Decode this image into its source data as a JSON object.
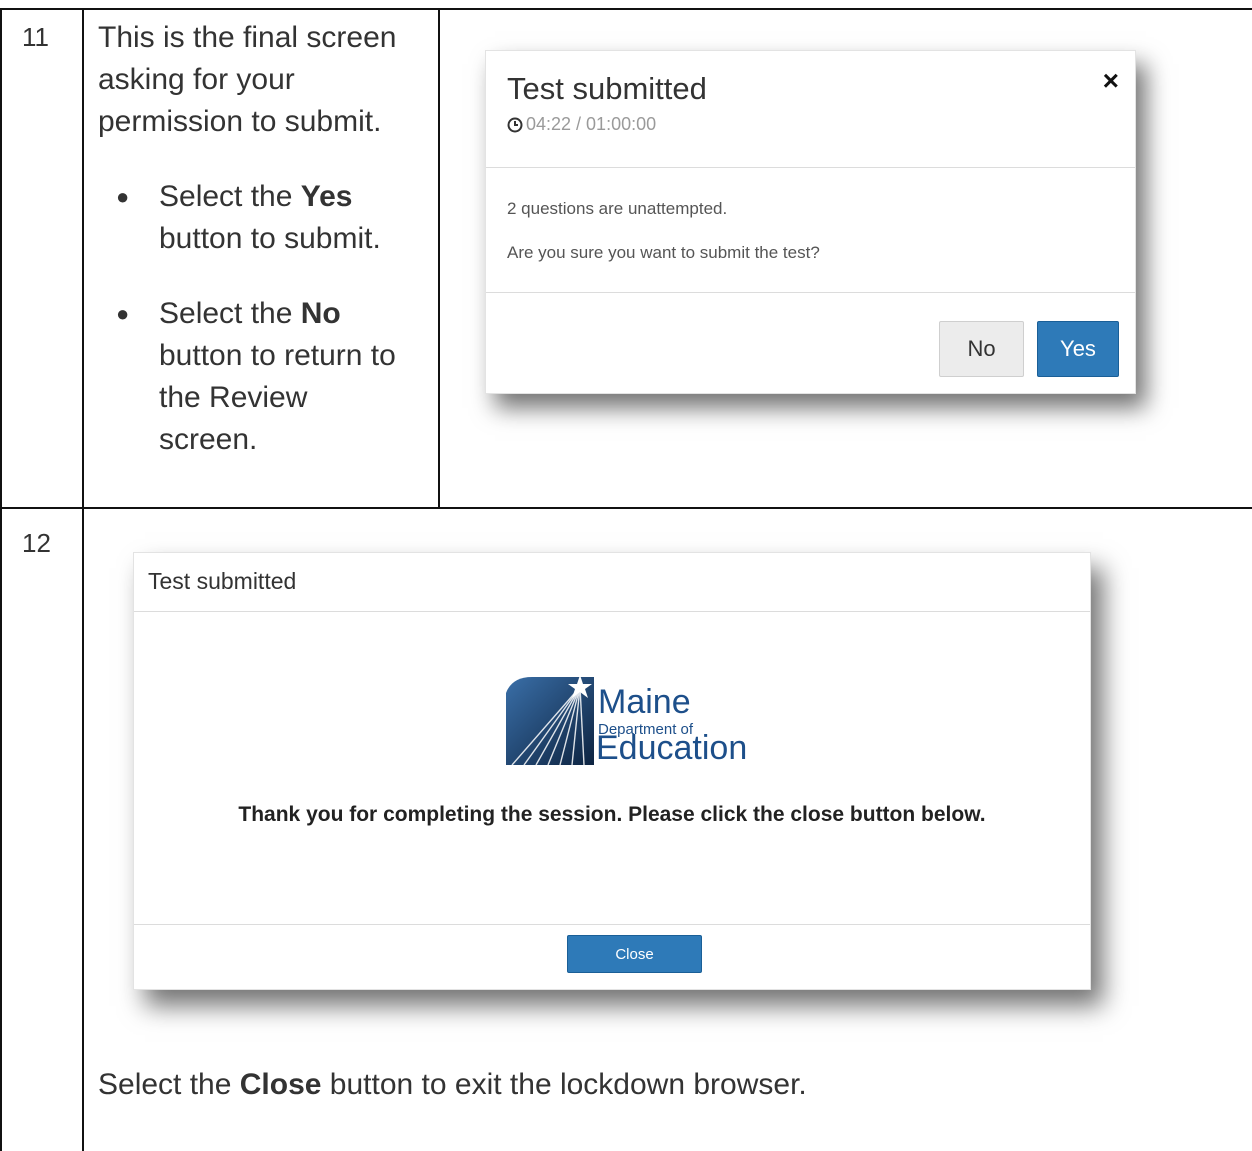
{
  "step11": {
    "number": "11",
    "intro": [
      "This is the final screen",
      "asking for your",
      "permission to submit."
    ],
    "bullet1": {
      "prefix": "Select the ",
      "bold": "Yes",
      "rest": "button to submit."
    },
    "bullet2": {
      "prefix": "Select the ",
      "bold": "No",
      "rest1": "button to return to",
      "rest2": "the Review",
      "rest3": "screen."
    },
    "dialog": {
      "title": "Test submitted",
      "timer": "04:22 / 01:00:00",
      "close_glyph": "×",
      "message1": "2 questions are unattempted.",
      "message2": "Are you sure you want to submit the test?",
      "no_label": "No",
      "yes_label": "Yes"
    }
  },
  "step12": {
    "number": "12",
    "dialog": {
      "title": "Test submitted",
      "logo": {
        "line1": "Maine",
        "line2": "Department of",
        "line3": "Education"
      },
      "message": "Thank you for completing the session.  Please click the close button below.",
      "close_label": "Close"
    },
    "instruction": {
      "prefix": "Select the ",
      "bold": "Close",
      "rest": " button to exit the lockdown browser."
    }
  },
  "colors": {
    "primary_button": "#2e7ab8",
    "logo_blue": "#1d4f8a"
  }
}
